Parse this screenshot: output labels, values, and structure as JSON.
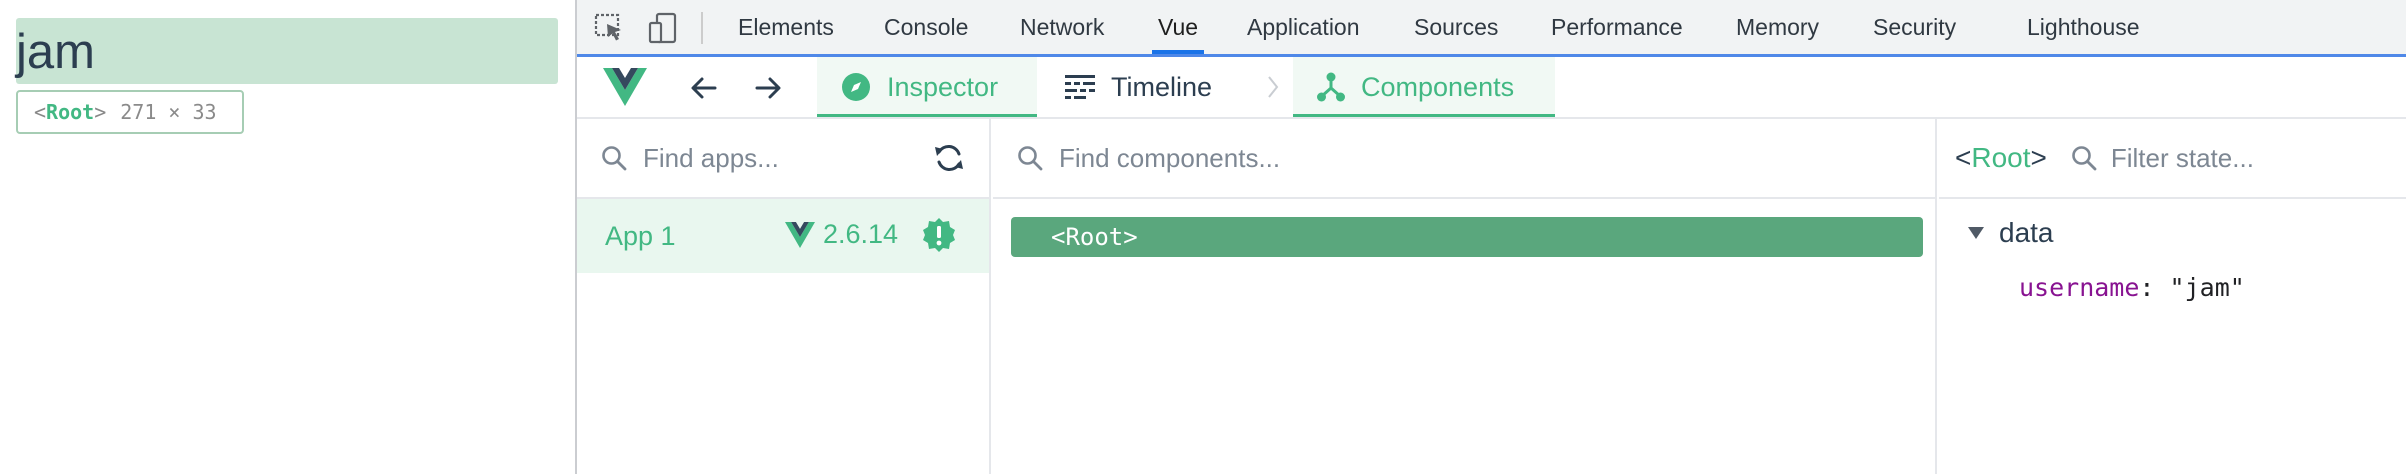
{
  "page": {
    "text": "jam",
    "tooltip": {
      "tag_open": "<",
      "name": "Root",
      "tag_close": ">",
      "dims": "271 × 33"
    }
  },
  "devtools": {
    "tabs": [
      "Elements",
      "Console",
      "Network",
      "Vue",
      "Application",
      "Sources",
      "Performance",
      "Memory",
      "Security",
      "Lighthouse"
    ],
    "active_tab": "Vue",
    "icons": [
      "inspect-element-icon",
      "device-toolbar-icon"
    ]
  },
  "vue": {
    "tabs": {
      "inspector": "Inspector",
      "timeline": "Timeline",
      "components": "Components"
    },
    "apps_search": {
      "placeholder": "Find apps..."
    },
    "apps": [
      {
        "name": "App 1",
        "version": "2.6.14"
      }
    ],
    "components_search": {
      "placeholder": "Find components..."
    },
    "component_tree": [
      {
        "label": "<Root>"
      }
    ],
    "state": {
      "tag_open": "<",
      "name": "Root",
      "tag_close": ">",
      "filter_placeholder": "Filter state...",
      "section": "data",
      "props": [
        {
          "key": "username",
          "colon": ":",
          "value": "\"jam\""
        }
      ]
    },
    "colors": {
      "accent": "#42b883",
      "selected_row": "#5aa77d",
      "highlight": "#c8e4d3"
    }
  }
}
